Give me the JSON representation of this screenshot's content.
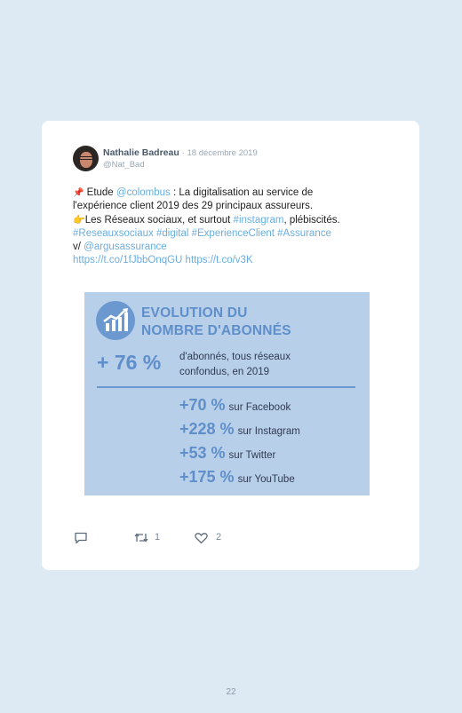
{
  "tweet": {
    "author_name": "Nathalie Badreau",
    "date": "· 18 décembre 2019",
    "handle": "@Nat_Bad",
    "text": {
      "pin": "📌",
      "l1_a": " Etude ",
      "mention_colombus": "@colombus",
      "l1_b": " : La digitalisation au service de",
      "l2": "l'expérience client 2019 des 29 principaux assureurs.",
      "hand": "👉",
      "l3_a": "Les Réseaux sociaux, et surtout ",
      "hashtag_instagram": "#instagram",
      "l3_b": ", plébiscités.",
      "hashtags_line": "#Reseauxsociaux #digital #ExperienceClient #Assurance",
      "via": "v/ ",
      "mention_argus": "@argusassurance",
      "links": "https://t.co/1fJbbOnqGU https://t.co/v3K"
    },
    "infographic": {
      "title_line1": "EVOLUTION DU",
      "title_line2": "NOMBRE D'ABONNÉS",
      "headline_pct": "+ 76 %",
      "headline_caption_l1": "d'abonnés, tous réseaux",
      "headline_caption_l2": "confondus, en 2019",
      "rows": [
        {
          "pct": "+70 %",
          "network": "sur Facebook"
        },
        {
          "pct": "+228 %",
          "network": "sur Instagram"
        },
        {
          "pct": "+53 %",
          "network": "sur Twitter"
        },
        {
          "pct": "+175 %",
          "network": "sur YouTube"
        }
      ]
    },
    "actions": {
      "reply_icon": "reply-icon",
      "retweet_icon": "retweet-icon",
      "retweet_count": "1",
      "like_icon": "heart-icon",
      "like_count": "2"
    }
  },
  "page_number": "22"
}
